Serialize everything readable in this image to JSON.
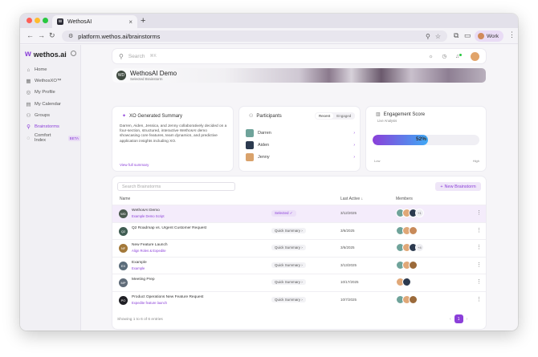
{
  "browser": {
    "tab_title": "WethosAI",
    "tab_close": "×",
    "new_tab": "+",
    "url": "platform.wethos.ai/brainstorms",
    "profile_label": "Work"
  },
  "sidebar": {
    "logo_text": "wethos.ai",
    "items": [
      {
        "label": "Home",
        "icon": "⌂"
      },
      {
        "label": "WethosXO™",
        "icon": "▦"
      },
      {
        "label": "My Profile",
        "icon": "◎"
      },
      {
        "label": "My Calendar",
        "icon": "▤"
      },
      {
        "label": "Groups",
        "icon": "⚇"
      },
      {
        "label": "Brainstorms",
        "icon": "⚲"
      },
      {
        "label": "Comfort Index",
        "icon": "◌"
      }
    ],
    "beta_label": "BETA"
  },
  "search": {
    "placeholder": "Search",
    "shortcut": "⌘K"
  },
  "banner": {
    "title": "WethosAI Demo",
    "subtitle": "Selected Brainstorm",
    "initials": "WD"
  },
  "summary": {
    "title": "XO Generated Summary",
    "text": "Darren, Aiden, Jessica, and Jenny collaboratively decided on a four-section, structured, interactive WethosAI demo showcasing core features, team dynamics, and predictive application insights including XO.",
    "link": "View full summary"
  },
  "participants": {
    "title": "Participants",
    "tabs": [
      "Recent",
      "Engaged"
    ],
    "people": [
      {
        "name": "Darren",
        "color": "#6fa39a"
      },
      {
        "name": "Aiden",
        "color": "#2c3a4f"
      },
      {
        "name": "Jenny",
        "color": "#d9a26b"
      }
    ]
  },
  "engagement": {
    "title": "Engagement Score",
    "subtitle": "Live Analysis",
    "value": 52,
    "value_label": "52%",
    "low": "Low",
    "high": "High"
  },
  "table": {
    "search_placeholder": "Search Brainstorms",
    "new_button": "New Brainstorm",
    "headers": {
      "name": "Name",
      "last_active": "Last Active ↓",
      "members": "Members"
    },
    "rows": [
      {
        "initials": "WD",
        "name": "WethosAI Demo",
        "desc": "Example Demo Script",
        "status": "Selected ✓",
        "selected": true,
        "date": "3/12/2025",
        "members": [
          "#6fa39a",
          "#e0a878",
          "#2c3a4f"
        ],
        "more": "+1"
      },
      {
        "initials": "Q2",
        "name": "Q2 Roadmap vs. Urgent Customer Request",
        "desc": "",
        "status": "Quick Summary ›",
        "selected": false,
        "date": "3/6/2025",
        "members": [
          "#6fa39a",
          "#e0a878",
          "#c88a5a"
        ],
        "more": ""
      },
      {
        "initials": "NF",
        "name": "New Feature Launch",
        "desc": "Align Roles & Expedite",
        "status": "Quick Summary ›",
        "selected": false,
        "date": "3/6/2025",
        "members": [
          "#6fa39a",
          "#e0a878",
          "#2c3a4f"
        ],
        "more": "+4"
      },
      {
        "initials": "EX",
        "name": "Example",
        "desc": "Example",
        "status": "Quick Summary ›",
        "selected": false,
        "date": "3/13/2025",
        "members": [
          "#6fa39a",
          "#e0a878",
          "#9b6a3a"
        ],
        "more": ""
      },
      {
        "initials": "MP",
        "name": "Meeting Prep",
        "desc": "",
        "status": "Quick Summary ›",
        "selected": false,
        "date": "10/17/2025",
        "members": [
          "#e0a878",
          "#2c3a4f"
        ],
        "more": ""
      },
      {
        "initials": "PO",
        "name": "Product Operations New Feature Request",
        "desc": "Expedite feature launch",
        "status": "Quick Summary ›",
        "selected": false,
        "date": "10/7/2025",
        "members": [
          "#6fa39a",
          "#e0a878",
          "#9b6a3a"
        ],
        "more": ""
      }
    ],
    "footer": "Showing 1 to 6 of 6 entries",
    "page": "1",
    "prev": "‹",
    "next": "›"
  }
}
